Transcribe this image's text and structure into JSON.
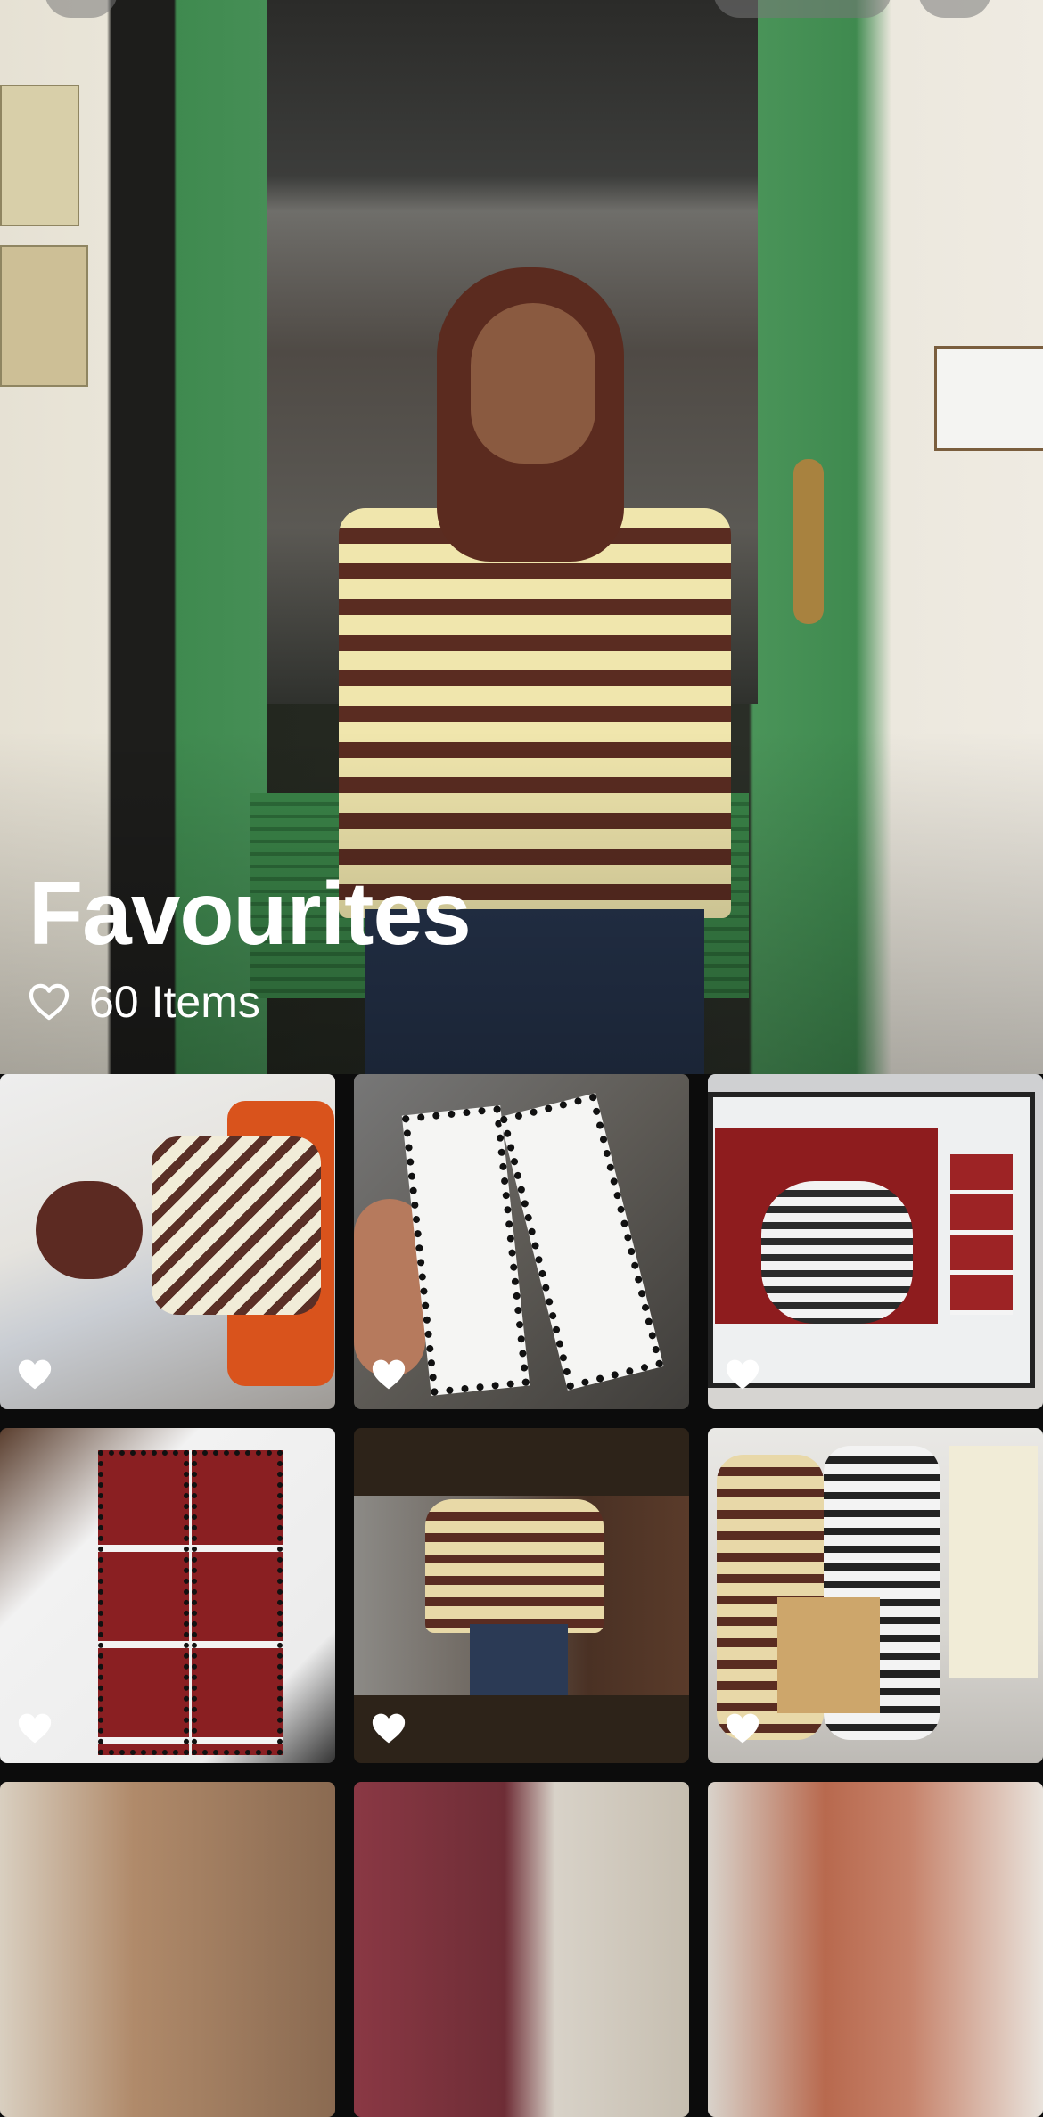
{
  "album": {
    "title": "Favourites",
    "count_number": "60",
    "count_label": "Items"
  },
  "icons": {
    "count_icon": "heart-outline-icon",
    "favourite_icon": "heart-filled-icon"
  },
  "colors": {
    "text": "#ffffff",
    "background": "#0c0c0c"
  },
  "grid": {
    "columns": 3,
    "items": [
      {
        "name": "photo-1",
        "favourite": true
      },
      {
        "name": "photo-2",
        "favourite": true
      },
      {
        "name": "photo-3",
        "favourite": true
      },
      {
        "name": "photo-4",
        "favourite": true
      },
      {
        "name": "photo-5",
        "favourite": true
      },
      {
        "name": "photo-6",
        "favourite": true
      },
      {
        "name": "photo-7",
        "favourite": false
      },
      {
        "name": "photo-8",
        "favourite": false
      },
      {
        "name": "photo-9",
        "favourite": false
      }
    ]
  }
}
